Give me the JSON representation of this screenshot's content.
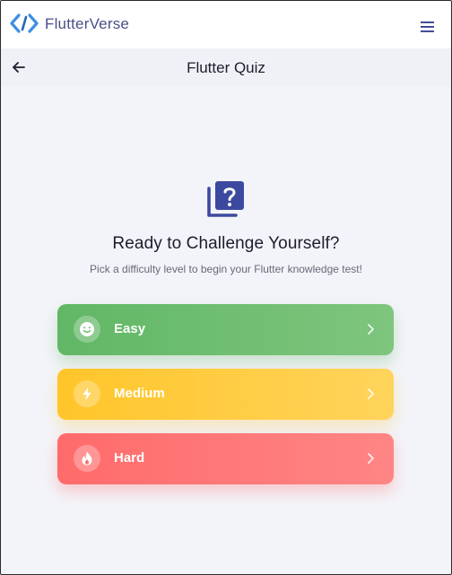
{
  "navbar": {
    "brand": "FlutterVerse",
    "logo_icon": "code-brackets-icon",
    "menu_icon": "hamburger-menu-icon",
    "accent_color": "#3f8fe0"
  },
  "header": {
    "title": "Flutter Quiz",
    "back_icon": "arrow-left-icon"
  },
  "main": {
    "hero_icon": "quiz-question-icon",
    "hero_icon_color": "#3b4a9e",
    "heading": "Ready to Challenge Yourself?",
    "subtitle": "Pick a difficulty level to begin your Flutter knowledge test!",
    "options": [
      {
        "label": "Easy",
        "icon": "smile-icon",
        "color": "#6abb6d"
      },
      {
        "label": "Medium",
        "icon": "bolt-icon",
        "color": "#ffc93a"
      },
      {
        "label": "Hard",
        "icon": "fire-icon",
        "color": "#ff7070"
      }
    ]
  }
}
